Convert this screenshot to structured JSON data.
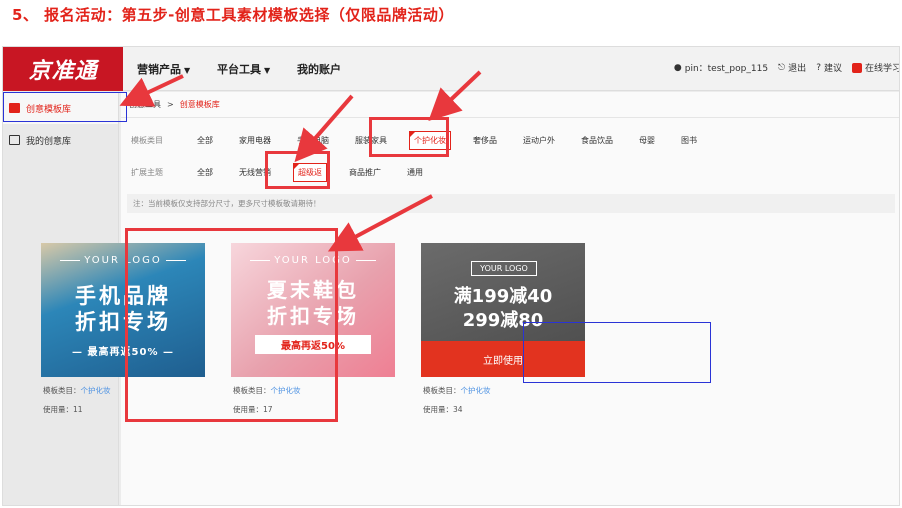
{
  "slide_title": "5、 报名活动：第五步-创意工具素材模板选择（仅限品牌活动）",
  "logo_text": "京准通",
  "nav": {
    "items": [
      "营销产品",
      "平台工具",
      "我的账户"
    ]
  },
  "user": {
    "pin": "pin：test_pop_115",
    "logout": "退出",
    "suggest": "建议",
    "study": "在线学习"
  },
  "sidebar": {
    "items": [
      "创意模板库",
      "我的创意库"
    ]
  },
  "breadcrumb": {
    "root": "创意工具",
    "sep": ">",
    "current": "创意模板库"
  },
  "filters": {
    "category_label": "模板类目",
    "categories": [
      "全部",
      "家用电器",
      "手机电脑",
      "服装家具",
      "个护化妆",
      "奢侈品",
      "运动户外",
      "食品饮品",
      "母婴",
      "图书"
    ],
    "theme_label": "扩展主题",
    "themes": [
      "全部",
      "无线营销",
      "超级返",
      "商品推广",
      "通用"
    ]
  },
  "notice": "注：当前模板仅支持部分尺寸，更多尺寸模板敬请期待！",
  "cards": [
    {
      "logo": "YOUR LOGO",
      "line1": "手机品牌",
      "line2": "折扣专场",
      "sub": "— 最高再返50% —",
      "category_label": "模板类目：",
      "category": "个护化妆",
      "usage": "使用量：11"
    },
    {
      "logo": "YOUR LOGO",
      "line1": "夏末鞋包",
      "line2": "折扣专场",
      "sub": "最高再返50%",
      "category_label": "模板类目：",
      "category": "个护化妆",
      "usage": "使用量：17"
    },
    {
      "logo": "YOUR LOGO",
      "line1": "满199减40",
      "line2": "299减80",
      "button": "立即使用",
      "category_label": "模板类目：",
      "category": "个护化妆",
      "usage": "使用量：34"
    }
  ],
  "colors": {
    "brand_red": "#c81623",
    "accent_red": "#e2231a",
    "annotation_red": "#e8383d",
    "annotation_blue": "#2a33d6",
    "link_blue": "#4a90e2"
  }
}
